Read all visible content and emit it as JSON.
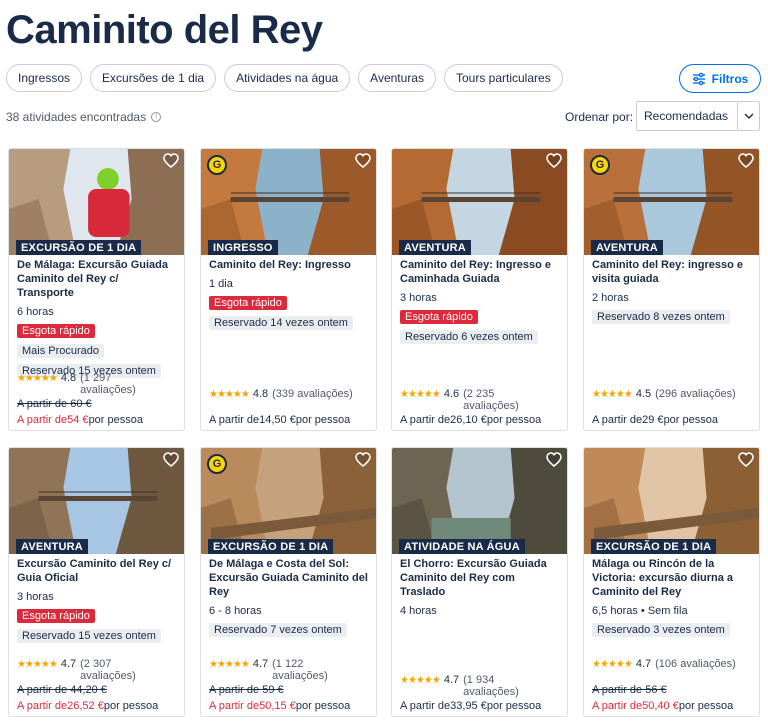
{
  "page": {
    "title": "Caminito del Rey"
  },
  "filters": {
    "chips": [
      "Ingressos",
      "Excursões de 1 dia",
      "Atividades na água",
      "Aventuras",
      "Tours particulares"
    ],
    "button_label": "Filtros"
  },
  "results": {
    "count_text": "38 atividades encontradas",
    "info_icon": "i"
  },
  "sort": {
    "label": "Ordenar por:",
    "selected": "Recomendadas"
  },
  "colors": {
    "brand_navy": "#1a2b49",
    "accent_blue": "#0071eb",
    "alert_red": "#dc2a3c",
    "star_gold": "#f5a500"
  },
  "icons": {
    "favorite": "heart-icon",
    "filter": "sliders-icon",
    "badge": "G",
    "stars": "★★★★★"
  },
  "cards": [
    {
      "category": "EXCURSÃO DE 1 DIA",
      "title": "De Málaga: Excursão Guiada Caminito del Rey c/ Transporte",
      "duration": "6 horas",
      "badges_red": [
        "Esgota rápido"
      ],
      "badges_grey": [
        "Mais Procurado",
        "Reservado 15 vezes ontem"
      ],
      "rating": "4.8",
      "reviews": "(1 297 avaliações)",
      "old_price": "A partir de 60 €",
      "price_prefix": "A partir de",
      "price": "54 €",
      "price_suffix": "por pessoa",
      "g_badge": false
    },
    {
      "category": "INGRESSO",
      "title": "Caminito del Rey: Ingresso",
      "duration": "1 dia",
      "badges_red": [
        "Esgota rápido"
      ],
      "badges_grey": [
        "Reservado 14 vezes ontem"
      ],
      "rating": "4.8",
      "reviews": "(339 avaliações)",
      "old_price": "",
      "price_prefix": "A partir de",
      "price": "14,50 €",
      "price_suffix": "por pessoa",
      "g_badge": true
    },
    {
      "category": "AVENTURA",
      "title": "Caminito del Rey: Ingresso e Caminhada Guiada",
      "duration": "3 horas",
      "badges_red": [
        "Esgota rápido"
      ],
      "badges_grey": [
        "Reservado 6 vezes ontem"
      ],
      "rating": "4.6",
      "reviews": "(2 235 avaliações)",
      "old_price": "",
      "price_prefix": "A partir de",
      "price": "26,10 €",
      "price_suffix": "por pessoa",
      "g_badge": false
    },
    {
      "category": "AVENTURA",
      "title": "Caminito del Rey: ingresso e visita guiada",
      "duration": "2 horas",
      "badges_red": [],
      "badges_grey": [
        "Reservado 8 vezes ontem"
      ],
      "rating": "4.5",
      "reviews": "(296 avaliações)",
      "old_price": "",
      "price_prefix": "A partir de",
      "price": "29 €",
      "price_suffix": "por pessoa",
      "g_badge": true
    },
    {
      "category": "AVENTURA",
      "title": "Excursão Caminito del Rey c/ Guia Oficial",
      "duration": "3 horas",
      "badges_red": [
        "Esgota rápido"
      ],
      "badges_grey": [
        "Reservado 15 vezes ontem"
      ],
      "rating": "4.7",
      "reviews": "(2 307 avaliações)",
      "old_price": "A partir de 44,20 €",
      "price_prefix": "A partir de",
      "price": "26,52 €",
      "price_suffix": "por pessoa",
      "g_badge": false
    },
    {
      "category": "EXCURSÃO DE 1 DIA",
      "title": "De Málaga e Costa del Sol: Excursão Guiada Caminito del Rey",
      "duration": "6 - 8 horas",
      "badges_red": [],
      "badges_grey": [
        "Reservado 7 vezes ontem"
      ],
      "rating": "4.7",
      "reviews": "(1 122 avaliações)",
      "old_price": "A partir de 59 €",
      "price_prefix": "A partir de",
      "price": "50,15 €",
      "price_suffix": "por pessoa",
      "g_badge": true
    },
    {
      "category": "ATIVIDADE NA ÁGUA",
      "title": "El Chorro: Excursão Guiada Caminito del Rey com Traslado",
      "duration": "4 horas",
      "badges_red": [],
      "badges_grey": [],
      "rating": "4.7",
      "reviews": "(1 934 avaliações)",
      "old_price": "",
      "price_prefix": "A partir de",
      "price": "33,95 €",
      "price_suffix": "por pessoa",
      "g_badge": false
    },
    {
      "category": "EXCURSÃO DE 1 DIA",
      "title": "Málaga ou Rincón de la Victoria: excursão diurna a Caminito del Rey",
      "duration": "6,5 horas • Sem fila",
      "badges_red": [],
      "badges_grey": [
        "Reservado 3 vezes ontem"
      ],
      "rating": "4.7",
      "reviews": "(106 avaliações)",
      "old_price": "A partir de 56 €",
      "price_prefix": "A partir de",
      "price": "50,40 €",
      "price_suffix": "por pessoa",
      "g_badge": false
    }
  ]
}
